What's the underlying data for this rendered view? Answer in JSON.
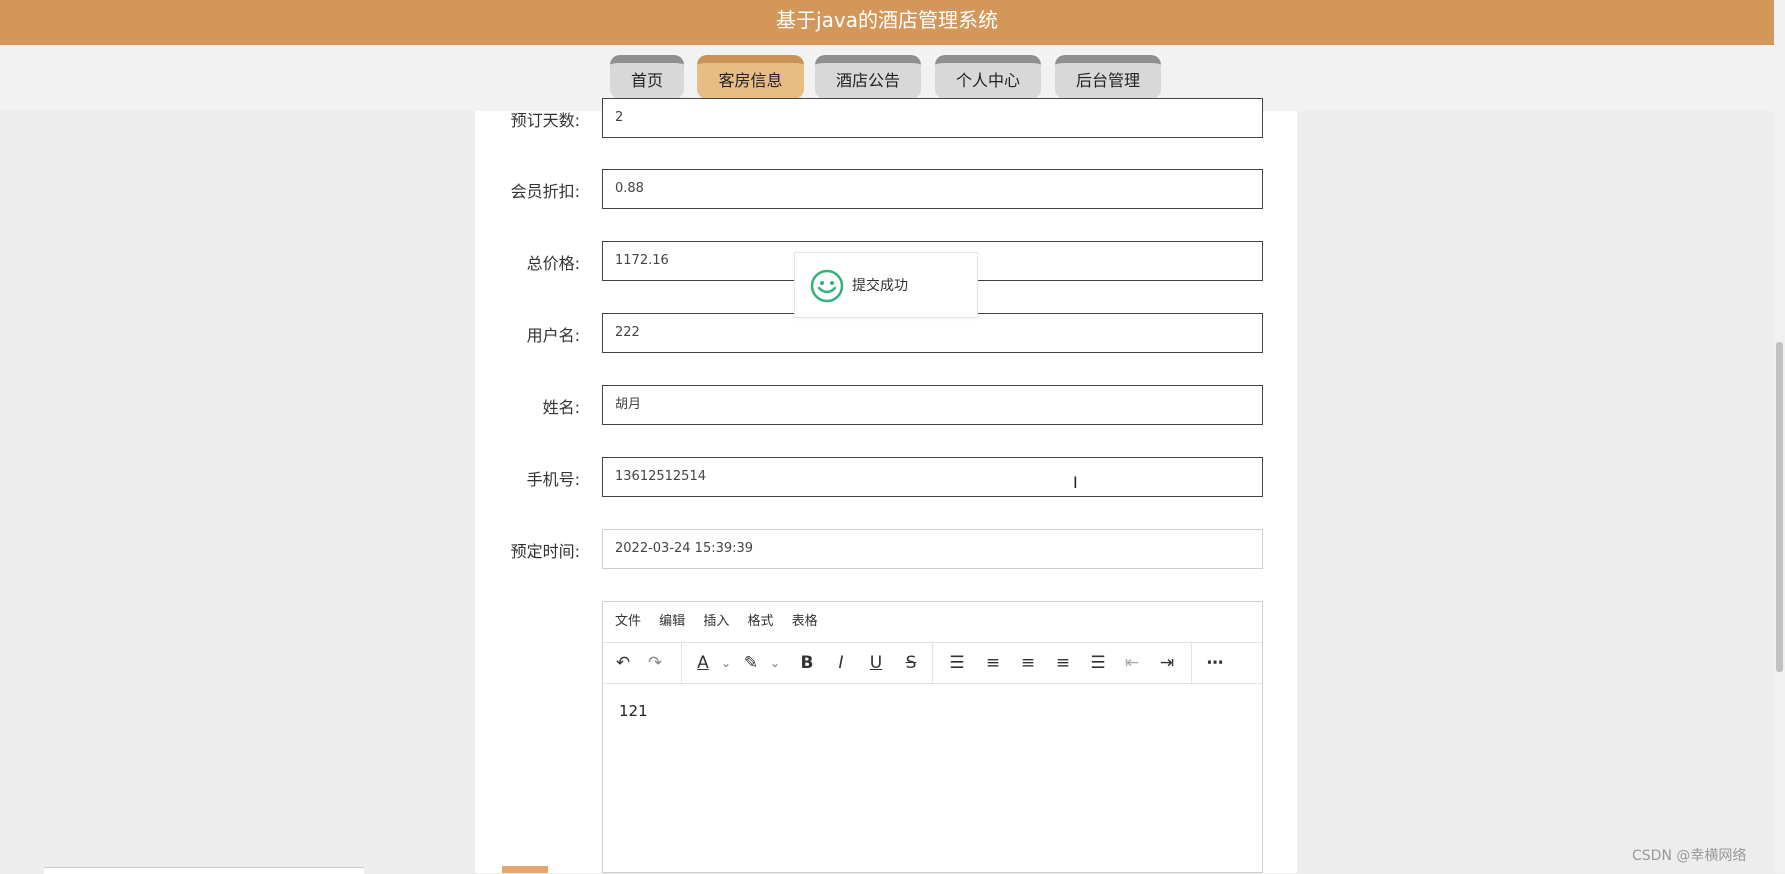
{
  "app": {
    "title": "基于java的酒店管理系统"
  },
  "nav": {
    "tabs": [
      {
        "label": "首页"
      },
      {
        "label": "客房信息",
        "active": true
      },
      {
        "label": "酒店公告"
      },
      {
        "label": "个人中心"
      },
      {
        "label": "后台管理"
      }
    ]
  },
  "form": {
    "fields": [
      {
        "label": "预订天数:",
        "value": "2"
      },
      {
        "label": "会员折扣:",
        "value": "0.88"
      },
      {
        "label": "总价格:",
        "value": "1172.16"
      },
      {
        "label": "用户名:",
        "value": "222"
      },
      {
        "label": "姓名:",
        "value": "胡月"
      },
      {
        "label": "手机号:",
        "value": "13612512514"
      },
      {
        "label": "预定时间:",
        "value": "2022-03-24 15:39:39"
      }
    ]
  },
  "editor": {
    "menus": [
      "文件",
      "编辑",
      "插入",
      "格式",
      "表格"
    ],
    "content": "121",
    "toolbar_icons": [
      "undo-icon",
      "redo-icon",
      "text-color-icon",
      "highlight-icon",
      "bold-icon",
      "italic-icon",
      "underline-icon",
      "strikethrough-icon",
      "line-height-icon",
      "align-left-icon",
      "align-center-icon",
      "align-right-icon",
      "justify-icon",
      "outdent-icon",
      "indent-icon",
      "more-icon"
    ]
  },
  "toast": {
    "message": "提交成功",
    "icon": "smile-icon"
  },
  "watermark": "CSDN @幸横网络",
  "colors": {
    "header": "#d29759",
    "active_tab": "#e7bc85",
    "toast_icon": "#2fb37a"
  }
}
